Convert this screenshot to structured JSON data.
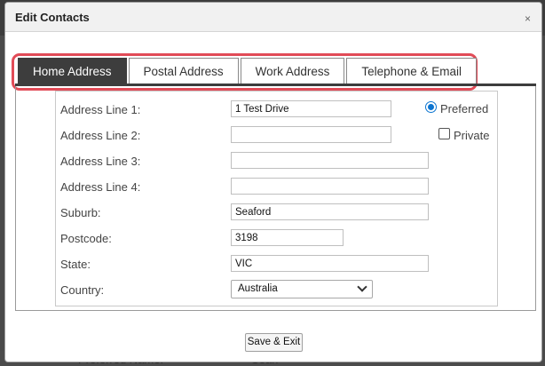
{
  "dialog": {
    "title": "Edit Contacts",
    "close_label": "×"
  },
  "tabs": [
    {
      "label": "Home Address",
      "active": true
    },
    {
      "label": "Postal Address",
      "active": false
    },
    {
      "label": "Work Address",
      "active": false
    },
    {
      "label": "Telephone & Email",
      "active": false
    }
  ],
  "form": {
    "address_line_1": {
      "label": "Address Line 1:",
      "value": "1 Test Drive"
    },
    "address_line_2": {
      "label": "Address Line 2:",
      "value": ""
    },
    "address_line_3": {
      "label": "Address Line 3:",
      "value": ""
    },
    "address_line_4": {
      "label": "Address Line 4:",
      "value": ""
    },
    "suburb": {
      "label": "Suburb:",
      "value": "Seaford"
    },
    "postcode": {
      "label": "Postcode:",
      "value": "3198"
    },
    "state": {
      "label": "State:",
      "value": "VIC"
    },
    "country": {
      "label": "Country:",
      "value": "Australia"
    }
  },
  "options": {
    "preferred": {
      "label": "Preferred",
      "selected": true
    },
    "private": {
      "label": "Private",
      "checked": false
    }
  },
  "actions": {
    "save_exit": "Save & Exit"
  },
  "background": {
    "label_partial": "Preferred Name:",
    "value_partial": "Sean"
  },
  "colors": {
    "active_tab": "#3d3d3d",
    "highlight": "#e14b57",
    "radio": "#0b74d0"
  }
}
